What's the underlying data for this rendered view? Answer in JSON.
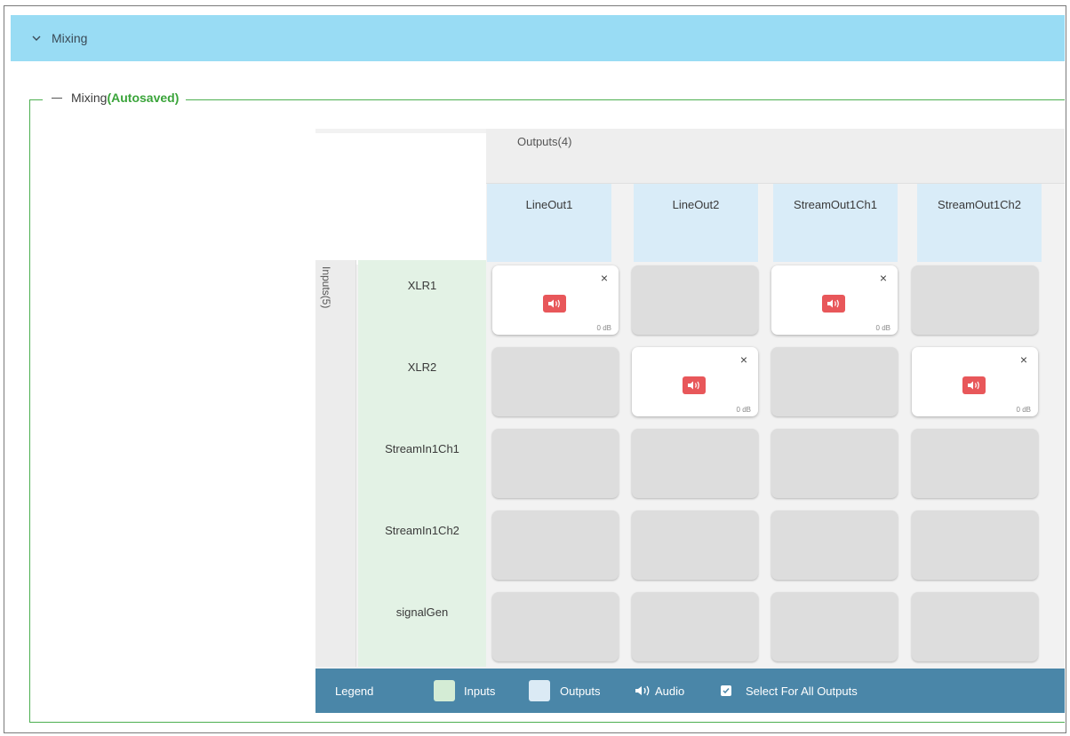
{
  "header": {
    "title": "Mixing"
  },
  "section": {
    "title": "Mixing",
    "status": "(Autosaved)"
  },
  "matrix": {
    "outputs_label": "Outputs(4)",
    "inputs_label": "Inputs(5)",
    "outputs": [
      "LineOut1",
      "LineOut2",
      "StreamOut1Ch1",
      "StreamOut1Ch2"
    ],
    "inputs": [
      "XLR1",
      "XLR2",
      "StreamIn1Ch1",
      "StreamIn1Ch2",
      "signalGen"
    ],
    "active_cells": [
      {
        "input": 0,
        "output": 0,
        "close": "×",
        "level": "0 dB"
      },
      {
        "input": 0,
        "output": 2,
        "close": "×",
        "level": "0 dB"
      },
      {
        "input": 1,
        "output": 1,
        "close": "×",
        "level": "0 dB"
      },
      {
        "input": 1,
        "output": 3,
        "close": "×",
        "level": "0 dB"
      }
    ]
  },
  "legend": {
    "title": "Legend",
    "inputs": "Inputs",
    "outputs": "Outputs",
    "audio": "Audio",
    "select_all": "Select For All Outputs"
  },
  "colors": {
    "header": "#99dcf4",
    "input_header": "#e3f2e5",
    "output_header": "#d9ecf8",
    "audio_icon": "#e8575a",
    "legend_bar": "#4a86a8",
    "autosaved": "#3aa43a"
  }
}
